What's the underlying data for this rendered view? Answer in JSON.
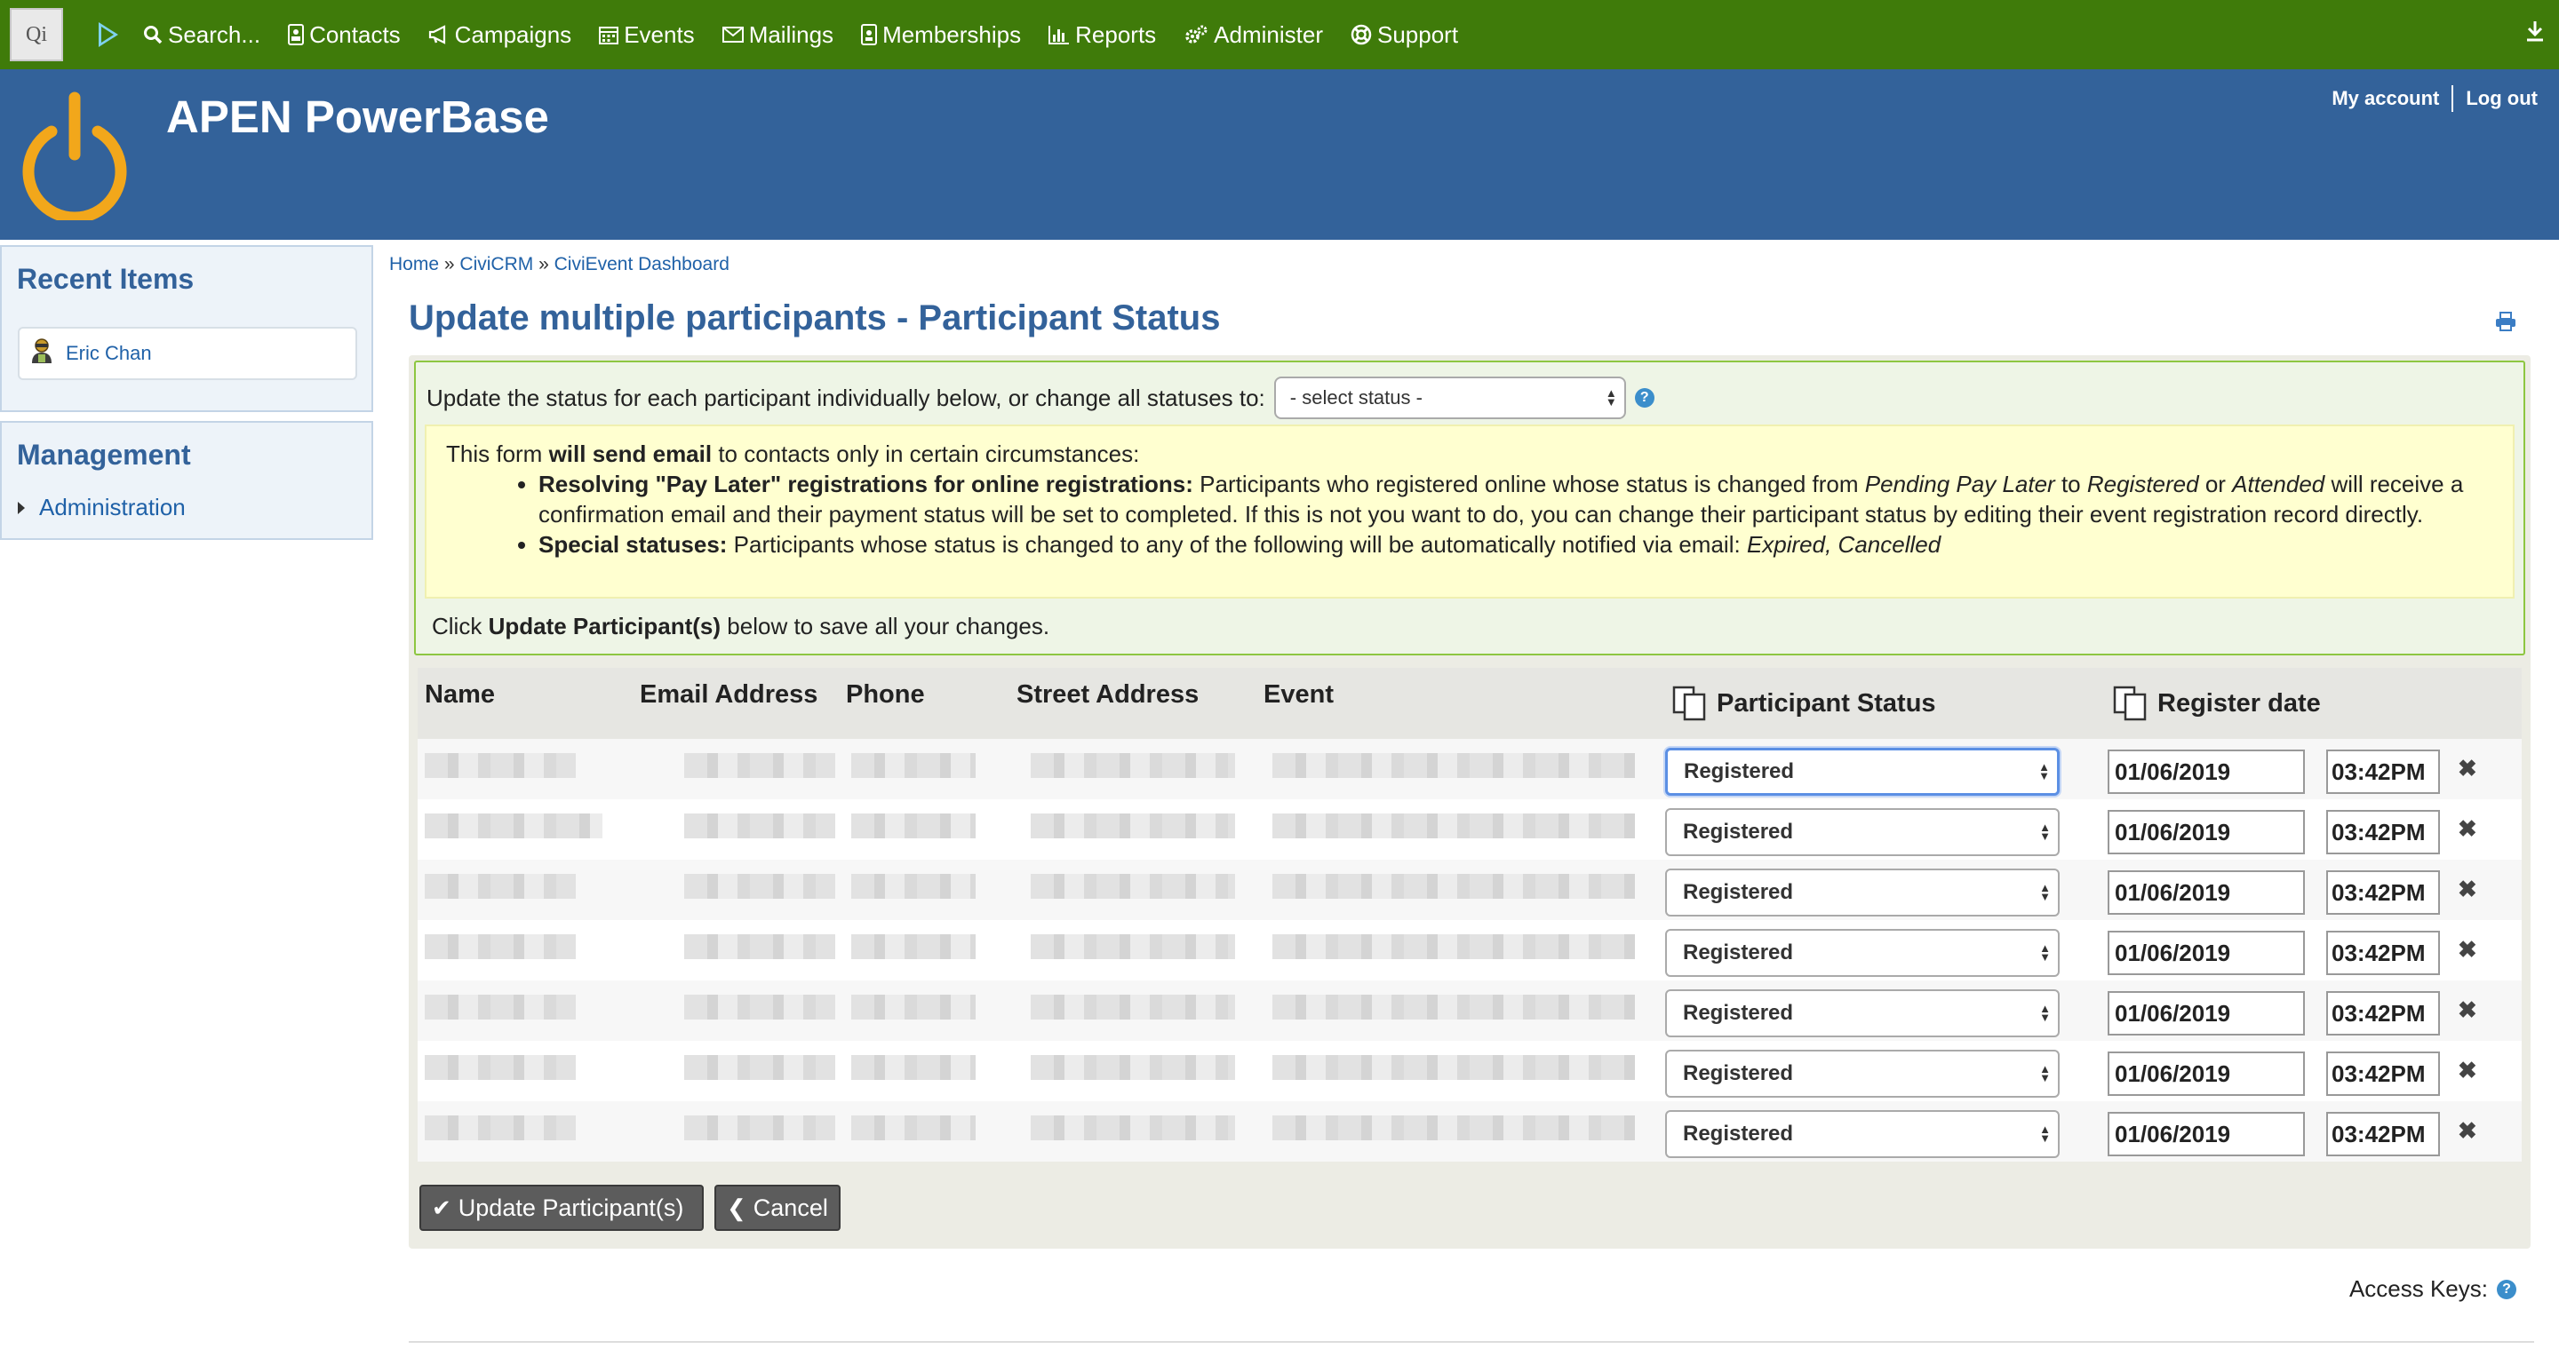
{
  "menubar": {
    "logo_text": "Qi",
    "items": [
      {
        "label": "Search...",
        "icon": "search-icon"
      },
      {
        "label": "Contacts",
        "icon": "contacts-icon"
      },
      {
        "label": "Campaigns",
        "icon": "megaphone-icon"
      },
      {
        "label": "Events",
        "icon": "calendar-icon"
      },
      {
        "label": "Mailings",
        "icon": "envelope-icon"
      },
      {
        "label": "Memberships",
        "icon": "id-card-icon"
      },
      {
        "label": "Reports",
        "icon": "bar-chart-icon"
      },
      {
        "label": "Administer",
        "icon": "gears-icon"
      },
      {
        "label": "Support",
        "icon": "life-ring-icon"
      }
    ],
    "bg_color": "#3f7b0a"
  },
  "header": {
    "site_name": "APEN PowerBase",
    "my_account": "My account",
    "log_out": "Log out",
    "bg_color": "#33629a",
    "logo_color": "#f2a71b"
  },
  "sidebar": {
    "recent_title": "Recent Items",
    "recent_items": [
      {
        "label": "Eric Chan",
        "icon": "person-icon"
      }
    ],
    "management_title": "Management",
    "management_items": [
      {
        "label": "Administration"
      }
    ]
  },
  "breadcrumb": {
    "items": [
      "Home",
      "CiviCRM",
      "CiviEvent Dashboard"
    ],
    "separator": "»"
  },
  "page_title": "Update multiple participants - Participant Status",
  "help": {
    "top_text": "Update the status for each participant individually below, or change all statuses to:",
    "select_placeholder": "- select status -",
    "notice_intro_1": "This form ",
    "notice_intro_bold": "will send email",
    "notice_intro_2": " to contacts only in certain circumstances:",
    "bullet1_bold": "Resolving \"Pay Later\" registrations for online registrations:",
    "bullet1_a": " Participants who registered online whose status is changed from ",
    "bullet1_i1": "Pending Pay Later",
    "bullet1_b": " to ",
    "bullet1_i2": "Registered",
    "bullet1_c": " or ",
    "bullet1_i3": "Attended",
    "bullet1_d": " will receive a confirmation email and their payment status will be set to completed. If this is not you want to do, you can change their participant status by editing their event registration record directly.",
    "bullet2_bold": "Special statuses:",
    "bullet2_a": " Participants whose status is changed to any of the following will be automatically notified via email: ",
    "bullet2_i": "Expired, Cancelled",
    "save_1": "Click ",
    "save_bold": "Update Participant(s)",
    "save_2": " below to save all your changes."
  },
  "table": {
    "headers": {
      "name": "Name",
      "email": "Email Address",
      "phone": "Phone",
      "street": "Street Address",
      "event": "Event",
      "status": "Participant Status",
      "register_date": "Register date"
    },
    "rows": [
      {
        "status": "Registered",
        "date": "01/06/2019",
        "time": "03:42PM"
      },
      {
        "status": "Registered",
        "date": "01/06/2019",
        "time": "03:42PM"
      },
      {
        "status": "Registered",
        "date": "01/06/2019",
        "time": "03:42PM"
      },
      {
        "status": "Registered",
        "date": "01/06/2019",
        "time": "03:42PM"
      },
      {
        "status": "Registered",
        "date": "01/06/2019",
        "time": "03:42PM"
      },
      {
        "status": "Registered",
        "date": "01/06/2019",
        "time": "03:42PM"
      },
      {
        "status": "Registered",
        "date": "01/06/2019",
        "time": "03:42PM"
      }
    ],
    "clear_glyph": "✖"
  },
  "buttons": {
    "update": "Update Participant(s)",
    "cancel": "Cancel"
  },
  "access_keys": "Access Keys:"
}
